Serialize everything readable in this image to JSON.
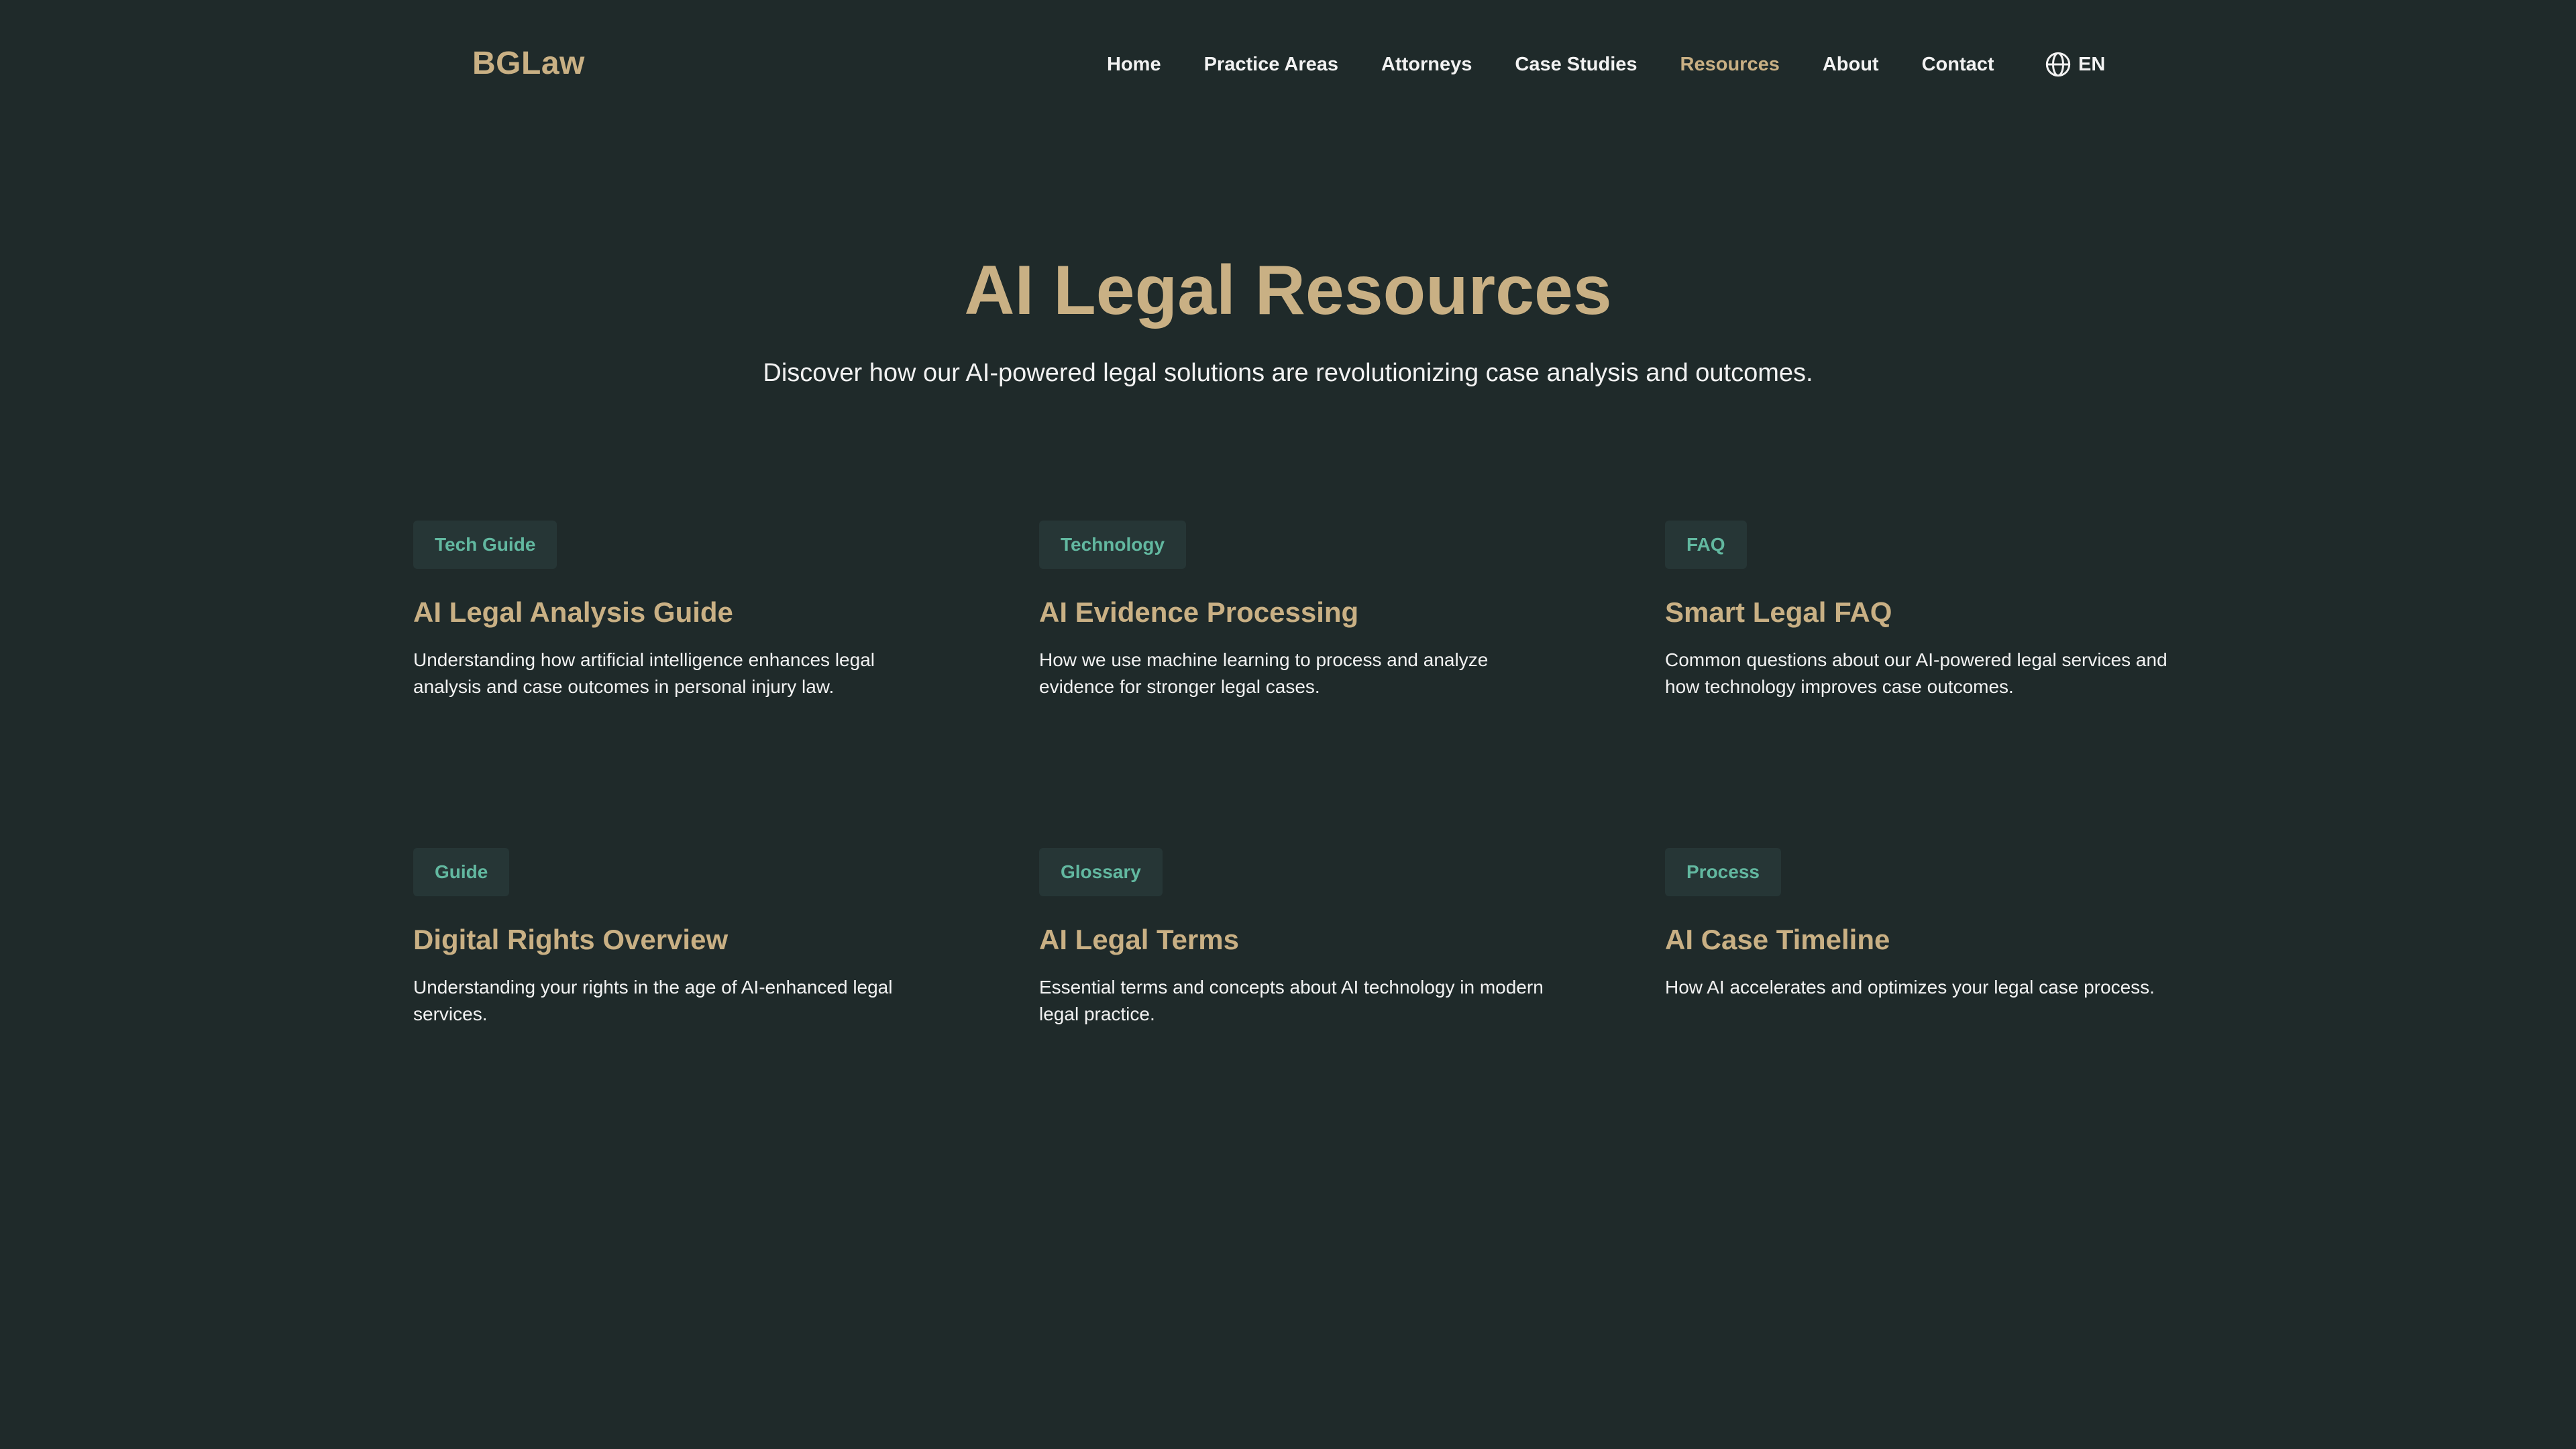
{
  "brand": {
    "logo_text": "BGLaw",
    "accent_color": "#c9b084",
    "background_color": "#1f2a2a",
    "tag_text_color": "#62b8a0"
  },
  "nav": {
    "items": [
      {
        "label": "Home",
        "active": false
      },
      {
        "label": "Practice Areas",
        "active": false
      },
      {
        "label": "Attorneys",
        "active": false
      },
      {
        "label": "Case Studies",
        "active": false
      },
      {
        "label": "Resources",
        "active": true
      },
      {
        "label": "About",
        "active": false
      },
      {
        "label": "Contact",
        "active": false
      }
    ],
    "language": {
      "icon": "globe-icon",
      "label": "EN"
    }
  },
  "hero": {
    "title": "AI Legal Resources",
    "subtitle": "Discover how our AI-powered legal solutions are revolutionizing case analysis and outcomes."
  },
  "resources": [
    {
      "tag": "Tech Guide",
      "title": "AI Legal Analysis Guide",
      "description": "Understanding how artificial intelligence enhances legal analysis and case outcomes in personal injury law."
    },
    {
      "tag": "Technology",
      "title": "AI Evidence Processing",
      "description": "How we use machine learning to process and analyze evidence for stronger legal cases."
    },
    {
      "tag": "FAQ",
      "title": "Smart Legal FAQ",
      "description": "Common questions about our AI-powered legal services and how technology improves case outcomes."
    },
    {
      "tag": "Guide",
      "title": "Digital Rights Overview",
      "description": "Understanding your rights in the age of AI-enhanced legal services."
    },
    {
      "tag": "Glossary",
      "title": "AI Legal Terms",
      "description": "Essential terms and concepts about AI technology in modern legal practice."
    },
    {
      "tag": "Process",
      "title": "AI Case Timeline",
      "description": "How AI accelerates and optimizes your legal case process."
    }
  ]
}
